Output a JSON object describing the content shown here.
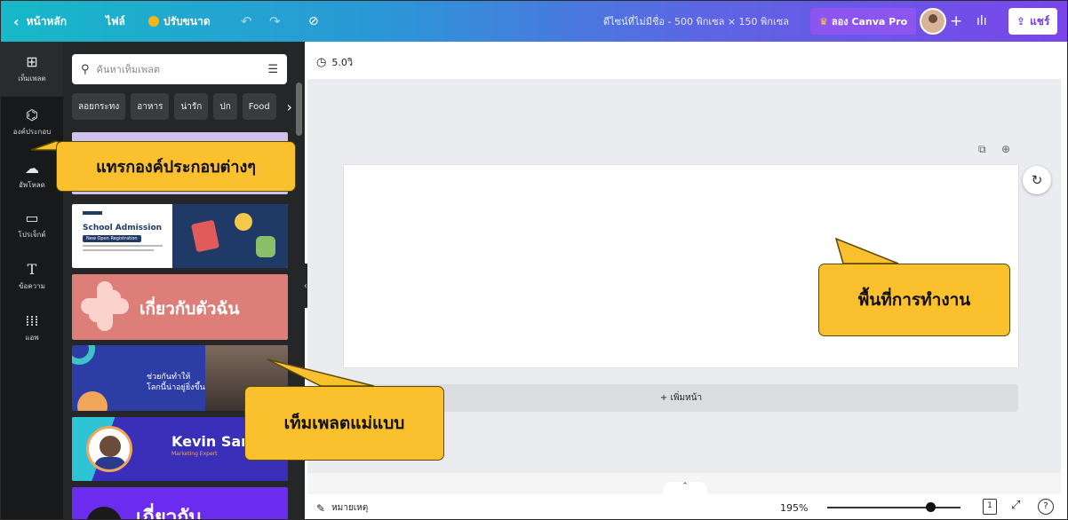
{
  "topbar": {
    "home": "หน้าหลัก",
    "file": "ไฟล์",
    "resize": "ปรับขนาด",
    "doc_title": "ดีไซน์ที่ไม่มีชื่อ - 500 พิกเซล × 150 พิกเซล",
    "try_pro": "ลอง Canva Pro",
    "share": "แชร์"
  },
  "rail": {
    "items": [
      "เท็มเพลต",
      "องค์ประกอบ",
      "อัพโหลด",
      "โปรเจ็กต์",
      "ข้อความ",
      "แอพ"
    ]
  },
  "panel": {
    "search_placeholder": "ค้นหาเท็มเพลต",
    "chips": [
      "ลอยกระทง",
      "อาหาร",
      "น่ารัก",
      "ปก",
      "Food"
    ]
  },
  "templates": {
    "school_title": "School Admission",
    "school_sub": "New Open Registration",
    "about_me": "เกี่ยวกับตัวฉัน",
    "help_line1": "ช่วยกันทำให้",
    "help_line2": "โลกนี้น่าอยู่ยิ่งขึ้น",
    "kevin_name": "Kevin Sang",
    "kevin_role": "Marketing Expert",
    "last": "เกี่ยวกับ"
  },
  "canvas": {
    "timer": "5.0วิ",
    "add_page": "+ เพิ่มหน้า"
  },
  "bottom": {
    "notes": "หมายเหตุ",
    "zoom": "195%",
    "page_count": "1",
    "zoom_fraction": 0.77
  },
  "callouts": {
    "elements": "แทรกองค์ประกอบต่างๆ",
    "workspace": "พื้นที่การทำงาน",
    "templates": "เท็มเพลตแม่แบบ"
  },
  "colors": {
    "accent": "#7a45ea",
    "callout": "#fbc02d",
    "rail": "#18191b",
    "panel": "#252627"
  }
}
